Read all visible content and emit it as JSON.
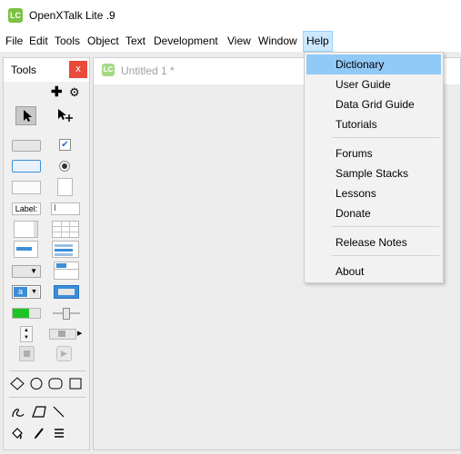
{
  "app": {
    "title": "OpenXTalk Lite .9",
    "logo_text": "LC",
    "brand_color": "#7cc242"
  },
  "menubar": {
    "items": [
      "File",
      "Edit",
      "Tools",
      "Object",
      "Text",
      "Development",
      "View",
      "Window",
      "Help"
    ],
    "active": "Help"
  },
  "tools_palette": {
    "title": "Tools",
    "close_label": "x",
    "add_icon": "plus-icon",
    "settings_icon": "gear-icon",
    "label_field_text": "Label:"
  },
  "document": {
    "title": "Untitled 1 *",
    "logo_text": "LC"
  },
  "help_menu": {
    "items": [
      "Dictionary",
      "User Guide",
      "Data Grid Guide",
      "Tutorials",
      "Forums",
      "Sample Stacks",
      "Lessons",
      "Donate",
      "Release Notes",
      "About"
    ],
    "highlighted": "Dictionary",
    "highlight_color": "#91c9f7"
  }
}
